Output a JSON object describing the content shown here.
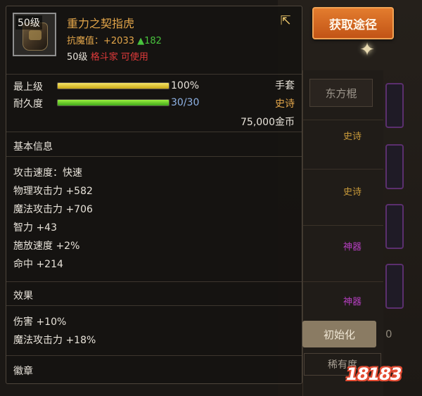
{
  "tooltip": {
    "level_tag": "50级",
    "item_name": "重力之契指虎",
    "resist_label": "抗魔值：",
    "resist_value": "+2033",
    "resist_up": "▲182",
    "req_level": "50级",
    "req_class": "格斗家 可使用",
    "share_icon": "share-arrow-icon",
    "upgrade_label": "最上级",
    "upgrade_pct": "100%",
    "upgrade_fraction": 1.0,
    "durability_label": "耐久度",
    "durability_value": "30/30",
    "durability_fraction": 1.0,
    "item_type": "手套",
    "item_grade": "史诗",
    "price": "75,000金币",
    "basic_title": "基本信息",
    "basic_stats": [
      "攻击速度：快速",
      "物理攻击力 +582",
      "魔法攻击力 +706",
      "智力 +43",
      "施放速度 +2%",
      "命中 +214"
    ],
    "effect_title": "效果",
    "effect_stats": [
      "伤害 +10%",
      "魔法攻击力 +18%"
    ],
    "emblem_title": "徽章"
  },
  "obtain_button": "获取途径",
  "background": {
    "tab_label": "东方棍",
    "grades": [
      "史诗",
      "史诗",
      "神器",
      "神器"
    ],
    "init_button": "初始化",
    "init_side": "0",
    "rarity_button": "稀有度"
  },
  "watermark": "18183",
  "colors": {
    "item_name": "#e3a64a",
    "resist_up": "#48c23d",
    "class_restriction": "#e03a3a",
    "epic": "#c99a3a",
    "myth": "#b43fbf",
    "obtain_button": "#d9671f"
  }
}
